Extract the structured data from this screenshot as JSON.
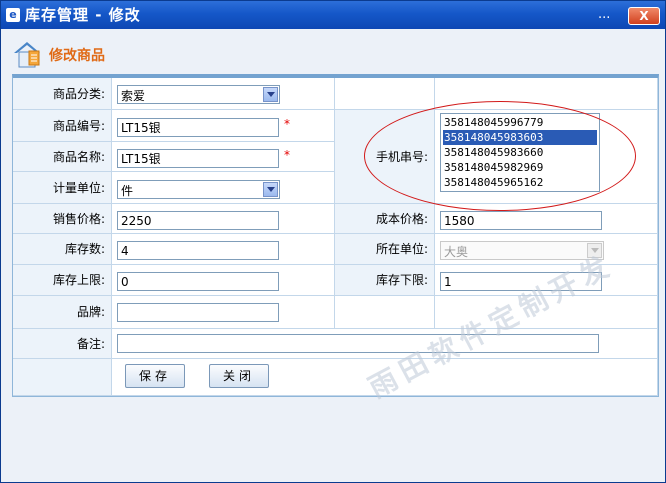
{
  "window": {
    "title": "库存管理 - 修改",
    "more_label": "...",
    "close_label": "X",
    "app_icon_glyph": "e"
  },
  "page": {
    "title": "修改商品"
  },
  "form": {
    "category_label": "商品分类:",
    "category_value": "索爱",
    "code_label": "商品编号:",
    "code_value": "LT15银",
    "name_label": "商品名称:",
    "name_value": "LT15银",
    "unit_label": "计量单位:",
    "unit_value": "件",
    "required_mark": "*",
    "serial_label": "手机串号:",
    "serials": [
      "358148045996779",
      "358148045983603",
      "358148045983660",
      "358148045982969",
      "358148045965162"
    ],
    "selected_serial_index": 1,
    "sale_price_label": "销售价格:",
    "sale_price_value": "2250",
    "cost_price_label": "成本价格:",
    "cost_price_value": "1580",
    "stock_label": "库存数:",
    "stock_value": "4",
    "location_label": "所在单位:",
    "location_value": "大奥",
    "stock_max_label": "库存上限:",
    "stock_max_value": "0",
    "stock_min_label": "库存下限:",
    "stock_min_value": "1",
    "brand_label": "品牌:",
    "brand_value": "",
    "remark_label": "备注:",
    "remark_value": "",
    "save_label": "保存",
    "close_label": "关闭"
  },
  "watermark": "雨田软件定制开发",
  "colors": {
    "titlebar": "#1557c8",
    "accent": "#e06a16",
    "highlight_oval": "#d21a1a",
    "selection": "#2a5bb5"
  }
}
